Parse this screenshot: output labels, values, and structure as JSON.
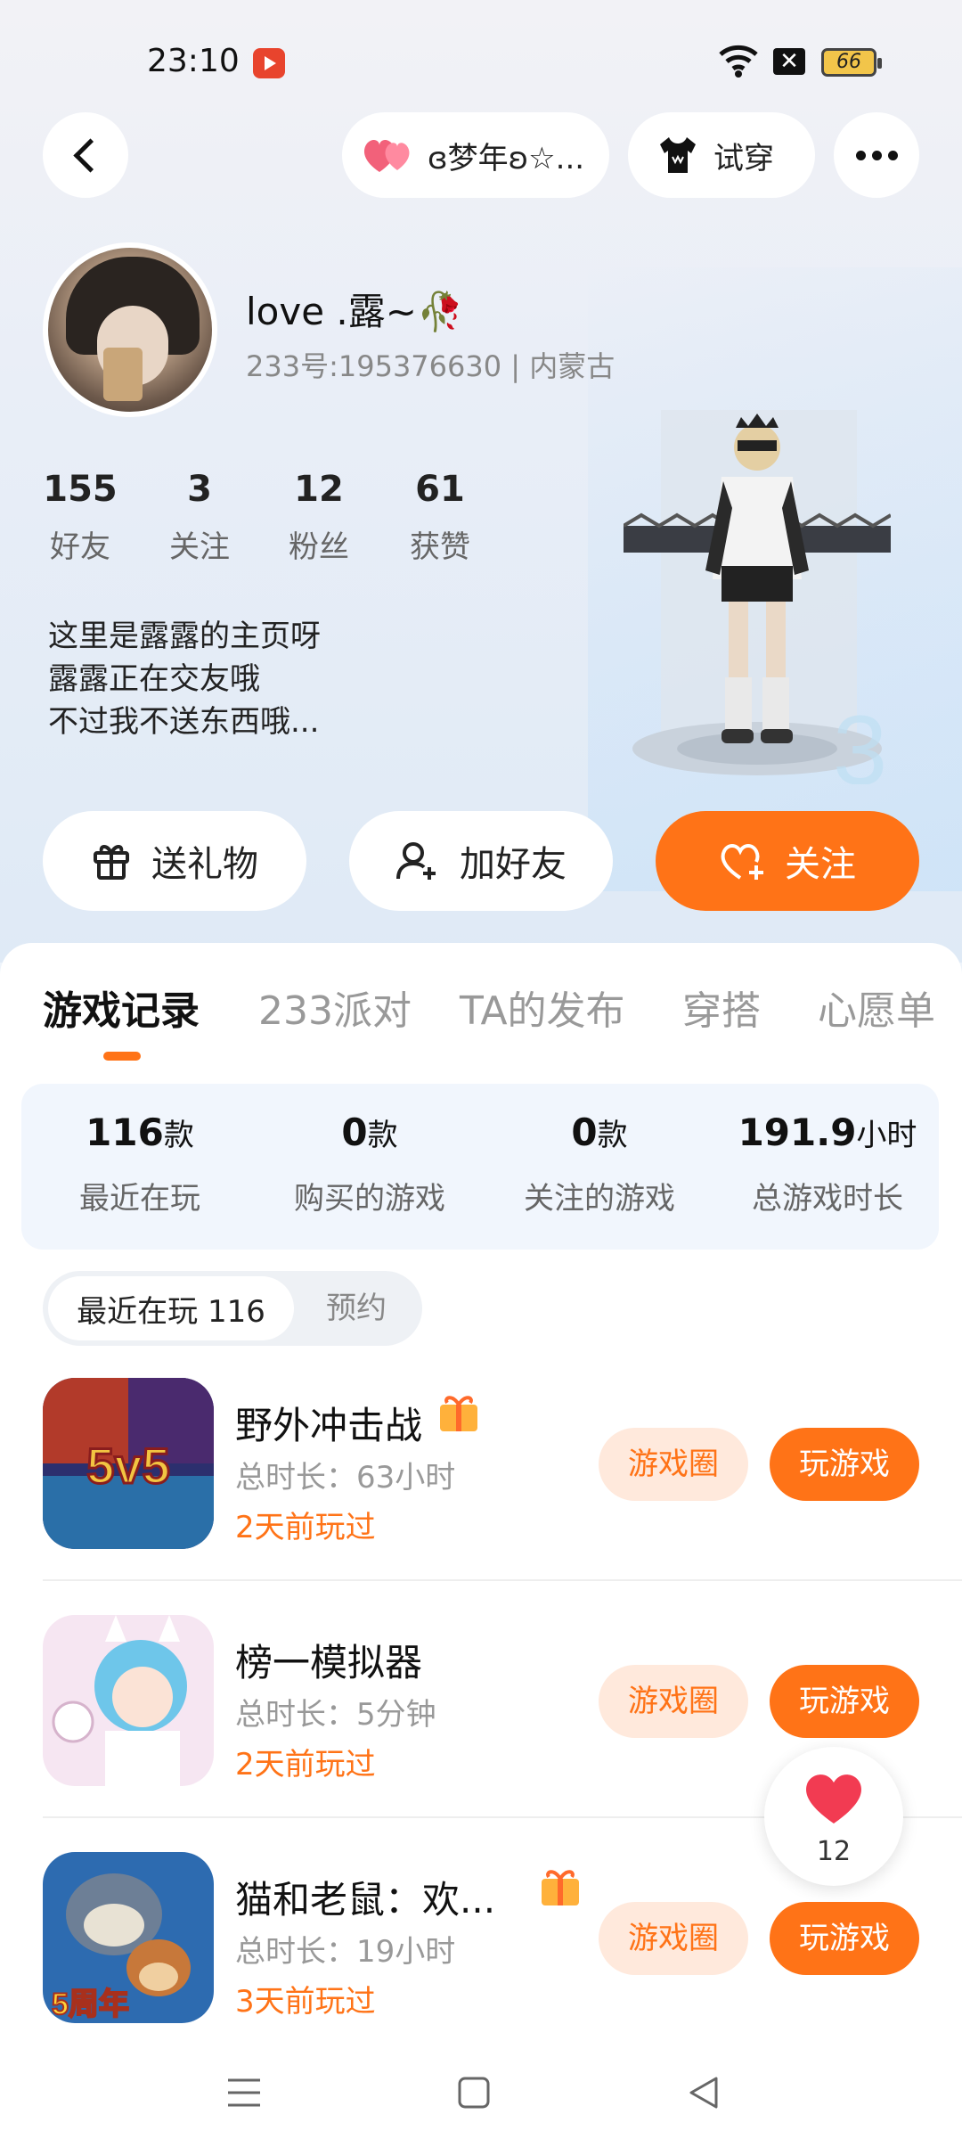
{
  "status_bar": {
    "time": "23:10",
    "battery": "66"
  },
  "header": {
    "nickname_badge": "ɞ梦年ʚ☆...",
    "try_on": "试穿"
  },
  "profile": {
    "username": "love .露~🥀",
    "id_line": "233号:195376630 | 内蒙古",
    "stats": [
      {
        "value": "155",
        "label": "好友"
      },
      {
        "value": "3",
        "label": "关注"
      },
      {
        "value": "12",
        "label": "粉丝"
      },
      {
        "value": "61",
        "label": "获赞"
      }
    ],
    "bio": [
      "这里是露露的主页呀",
      "露露正在交友哦",
      "不过我不送东西哦..."
    ]
  },
  "actions": {
    "gift": "送礼物",
    "add_friend": "加好友",
    "follow": "关注"
  },
  "tabs": [
    "游戏记录",
    "233派对",
    "TA的发布",
    "穿搭",
    "心愿单"
  ],
  "summary": [
    {
      "value": "116",
      "unit": "款",
      "label": "最近在玩"
    },
    {
      "value": "0",
      "unit": "款",
      "label": "购买的游戏"
    },
    {
      "value": "0",
      "unit": "款",
      "label": "关注的游戏"
    },
    {
      "value": "191.9",
      "unit": "小时",
      "label": "总游戏时长"
    }
  ],
  "segment": {
    "active": "最近在玩 116",
    "inactive": "预约"
  },
  "games": [
    {
      "name": "野外冲击战",
      "duration": "总时长：63小时",
      "last_played": "2天前玩过",
      "circle": "游戏圈",
      "play": "玩游戏"
    },
    {
      "name": "榜一模拟器",
      "duration": "总时长：5分钟",
      "last_played": "2天前玩过",
      "circle": "游戏圈",
      "play": "玩游戏"
    },
    {
      "name": "猫和老鼠：欢...",
      "duration": "总时长：19小时",
      "last_played": "3天前玩过",
      "circle": "游戏圈",
      "play": "玩游戏"
    }
  ],
  "likes": {
    "count": "12"
  },
  "colors": {
    "accent": "#ff7317",
    "accent_light": "#ffe9dc"
  }
}
